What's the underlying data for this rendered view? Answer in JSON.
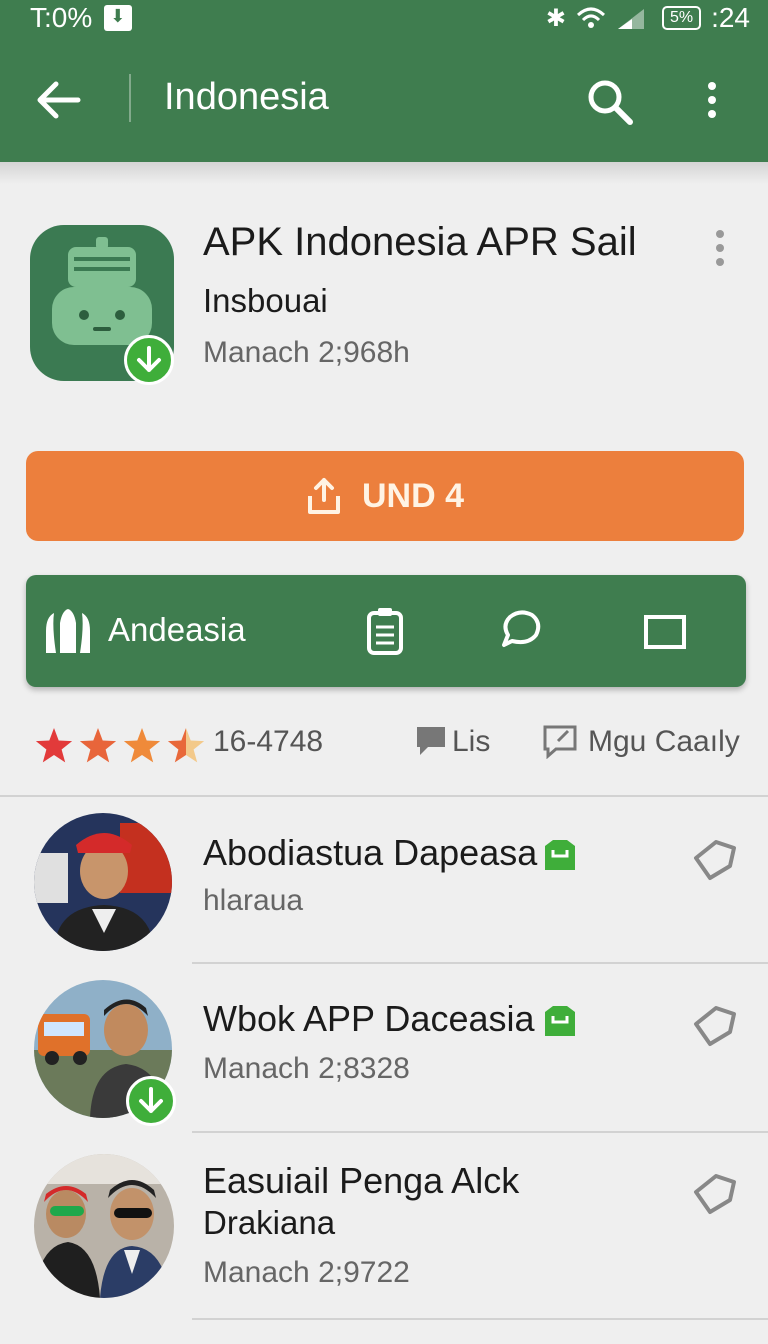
{
  "status": {
    "battery_text": "T:0%",
    "battery_level": "5%",
    "time": ":24"
  },
  "appbar": {
    "title": "Indonesia"
  },
  "app": {
    "name": "APK Indonesia APR Sail",
    "subtitle": "Insbouai",
    "meta": "Manach 2;968h"
  },
  "install": {
    "label": "UND 4"
  },
  "actions": {
    "brand_label": "Andeasia"
  },
  "rating": {
    "count": "16-4748",
    "lis_label": "Lis",
    "mgu_label": "Mgu Caaıly",
    "stars": 3.5
  },
  "list": [
    {
      "title": "Abodiastua Dapeasa",
      "subtitle": "hlaraua"
    },
    {
      "title": "Wbok  APP Daceasia",
      "subtitle": "Manach 2;8328"
    },
    {
      "title": "Easuiail Penga Alck",
      "title2": "Drakiana",
      "subtitle": "Manach 2;9722"
    }
  ],
  "colors": {
    "green": "#3f7d4f",
    "orange": "#ec7f3d",
    "badge_green": "#3fae3a"
  }
}
